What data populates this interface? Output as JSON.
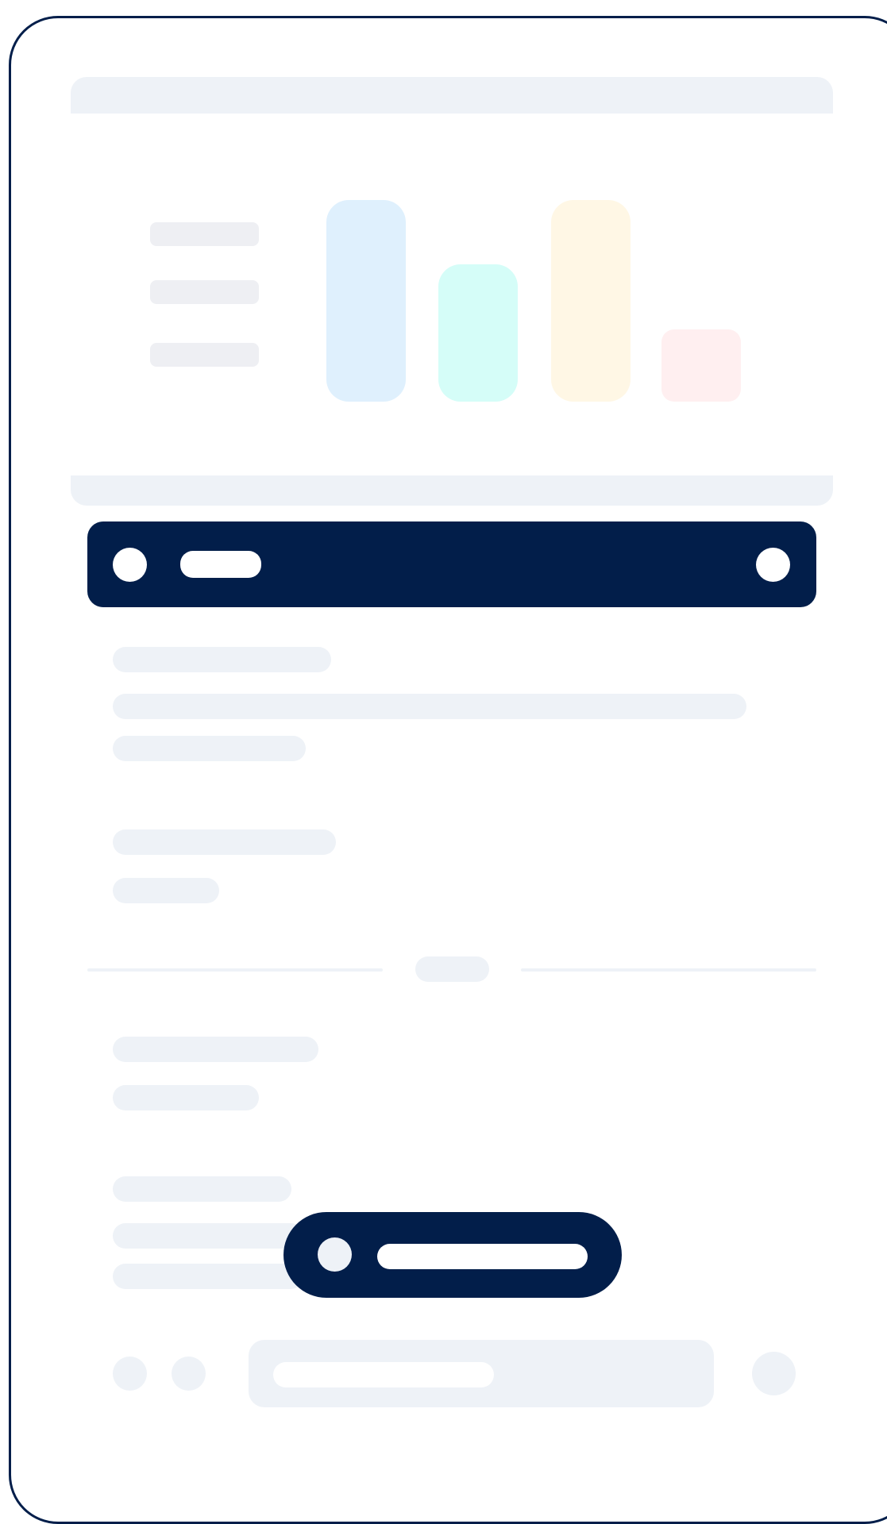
{
  "colors": {
    "frame_border": "#021e4a",
    "header_bar": "#021e4a",
    "skeleton": "#eef2f7",
    "bar_blue": "#dff0fd",
    "bar_cyan": "#d5fdf8",
    "bar_yellow": "#fff7e5",
    "bar_pink": "#ffeff0"
  },
  "chart_card": {
    "bars": [
      {
        "color_key": "bar_blue",
        "level": 1.0
      },
      {
        "color_key": "bar_cyan",
        "level": 0.68
      },
      {
        "color_key": "bar_yellow",
        "level": 1.0
      },
      {
        "color_key": "bar_pink",
        "level": 0.36
      }
    ]
  },
  "icons": {
    "header_left": "circle-icon",
    "header_right": "circle-icon",
    "floating_left": "circle-icon",
    "bottom_left_1": "circle-icon",
    "bottom_left_2": "circle-icon",
    "bottom_right": "circle-icon"
  }
}
